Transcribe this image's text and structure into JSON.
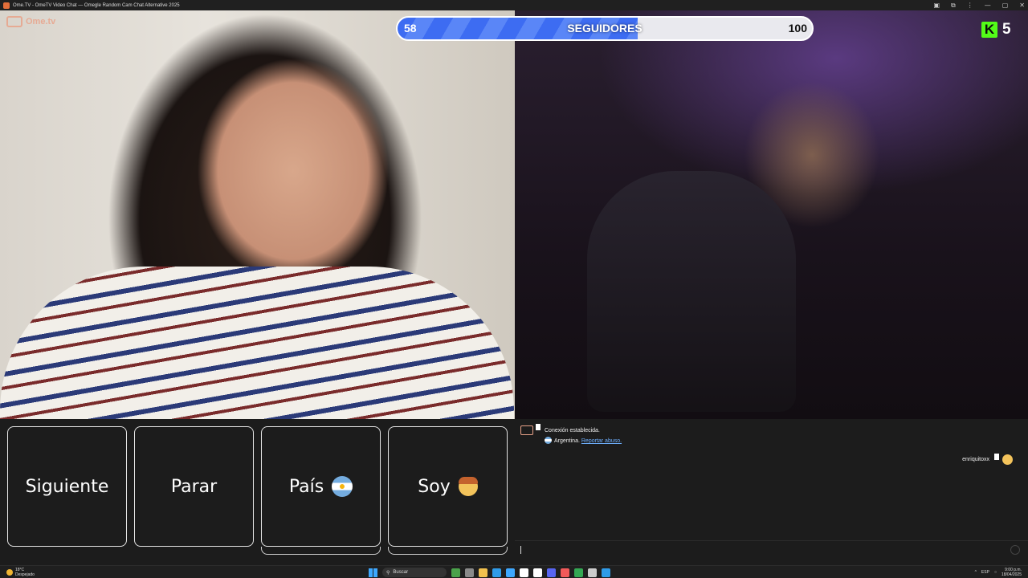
{
  "window": {
    "title": "Ome.TV - OmeTV Video Chat — Omegle Random Cam Chat Alternative 2025",
    "controls": [
      "▣",
      "⧉",
      "⋮",
      "—",
      "▢",
      "✕"
    ]
  },
  "left_video": {
    "logo_text": "Ome.tv"
  },
  "followers_bar": {
    "current": "58",
    "label": "SEGUIDORES",
    "goal": "100",
    "progress_fraction": 0.58,
    "fill_color": "#3d6cf2"
  },
  "kick": {
    "icon_letter": "K",
    "count": "5",
    "color": "#53fc18"
  },
  "buttons": {
    "next": "Siguiente",
    "stop": "Parar",
    "country": "País",
    "gender": "Soy"
  },
  "chat": {
    "connection": "Conexión establecida.",
    "country_name": "Argentina.",
    "report_link": "Reportar abuso.",
    "partner_name": "enriquitoxx"
  },
  "taskbar": {
    "temperature": "18°C",
    "weather": "Despejado",
    "search_placeholder": "Buscar",
    "language": "ESP",
    "time": "9:00 p.m.",
    "date": "18/04/2025",
    "app_colors": [
      "#4aa24a",
      "#8a8a8a",
      "#f2c14e",
      "#2f9be8",
      "#3ea8ff",
      "#ffffff",
      "#ffffff",
      "#5865f2",
      "#f25a5a",
      "#34a853",
      "#cccccc",
      "#2f9be8"
    ]
  }
}
